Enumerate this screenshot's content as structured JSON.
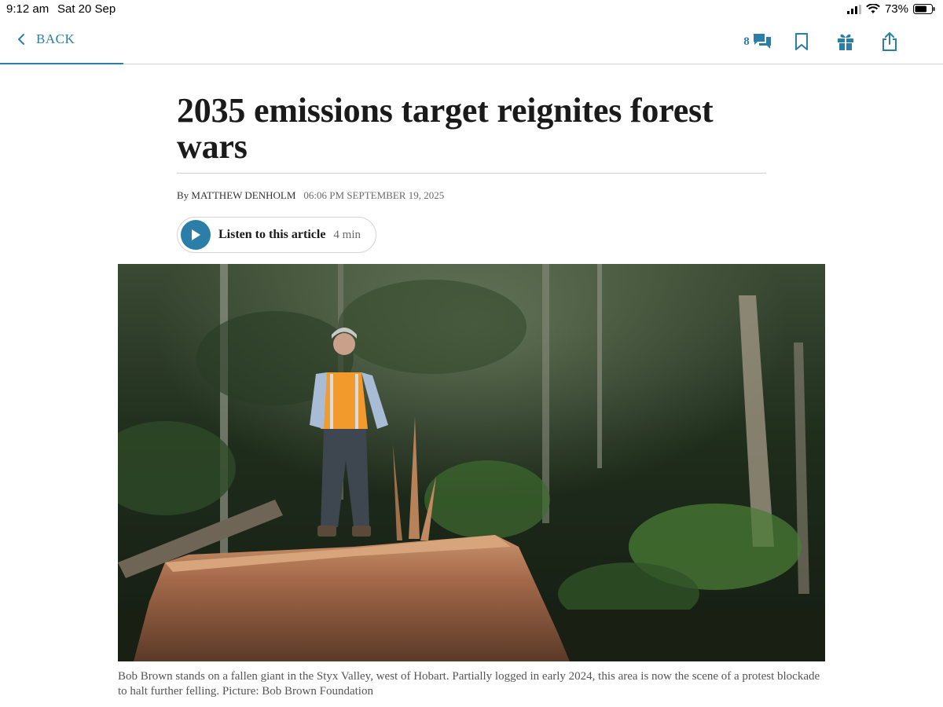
{
  "status_bar": {
    "time": "9:12 am",
    "date": "Sat 20 Sep",
    "battery": "73%"
  },
  "nav": {
    "back_label": "BACK",
    "comments_count": "8",
    "icons": [
      "chevron-left-icon",
      "comments-icon",
      "bookmark-icon",
      "gift-icon",
      "share-icon"
    ],
    "accent_color": "#2a7ea8"
  },
  "article": {
    "headline": "2035 emissions target reignites forest wars",
    "byline": "By MATTHEW DENHOLM",
    "timestamp": "06:06 PM SEPTEMBER 19, 2025",
    "listen_label": "Listen to this article",
    "listen_duration": "4 min",
    "caption": "Bob Brown stands on a fallen giant in the Styx Valley, west of Hobart. Partially logged in early 2024, this area is now the scene of a protest blockade to halt further felling. Picture: Bob Brown Foundation"
  }
}
